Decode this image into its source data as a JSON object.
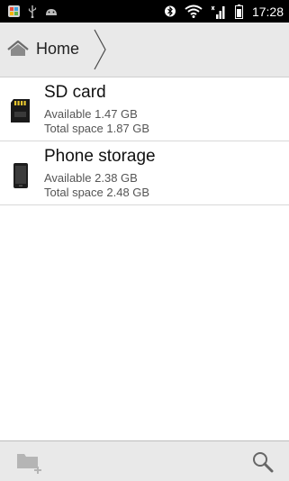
{
  "status_bar": {
    "time": "17:28",
    "icons": [
      "photos-notification-icon",
      "usb-icon",
      "android-debug-icon",
      "bluetooth-icon",
      "wifi-icon",
      "signal-icon",
      "battery-icon"
    ]
  },
  "breadcrumb": {
    "home_label": "Home"
  },
  "storage_list": [
    {
      "name": "SD card",
      "available": "Available 1.47 GB",
      "total": "Total space 1.87 GB",
      "icon": "sd-card-icon"
    },
    {
      "name": "Phone storage",
      "available": "Available 2.38 GB",
      "total": "Total space 2.48 GB",
      "icon": "phone-icon"
    }
  ],
  "toolbar": {
    "icons": [
      "new-folder-icon",
      "search-icon"
    ]
  },
  "colors": {
    "status_bar_bg": "#000000",
    "bar_bg": "#e9e9e9",
    "divider": "#d8d8d8"
  }
}
